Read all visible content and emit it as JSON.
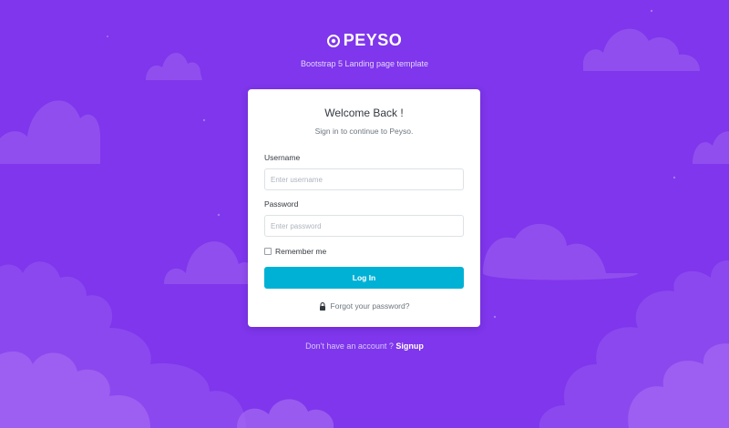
{
  "brand": {
    "logo_text": "PEYSO",
    "tagline": "Bootstrap 5 Landing page template"
  },
  "card": {
    "title": "Welcome Back !",
    "subtitle": "Sign in to continue to Peyso.",
    "username_label": "Username",
    "username_placeholder": "Enter username",
    "username_value": "",
    "password_label": "Password",
    "password_placeholder": "Enter password",
    "password_value": "",
    "remember_label": "Remember me",
    "remember_checked": false,
    "login_label": "Log In",
    "forgot_label": "Forgot your password?"
  },
  "footer": {
    "prompt": "Don't have an account ?",
    "signup_label": "Signup"
  },
  "colors": {
    "background": "#7f36ec",
    "cloud_light": "#9a5bf0",
    "cloud_lighter": "#a56cf2",
    "button": "#00b1d6"
  },
  "icons": {
    "logo": "logo-icon",
    "lock": "lock-icon"
  }
}
